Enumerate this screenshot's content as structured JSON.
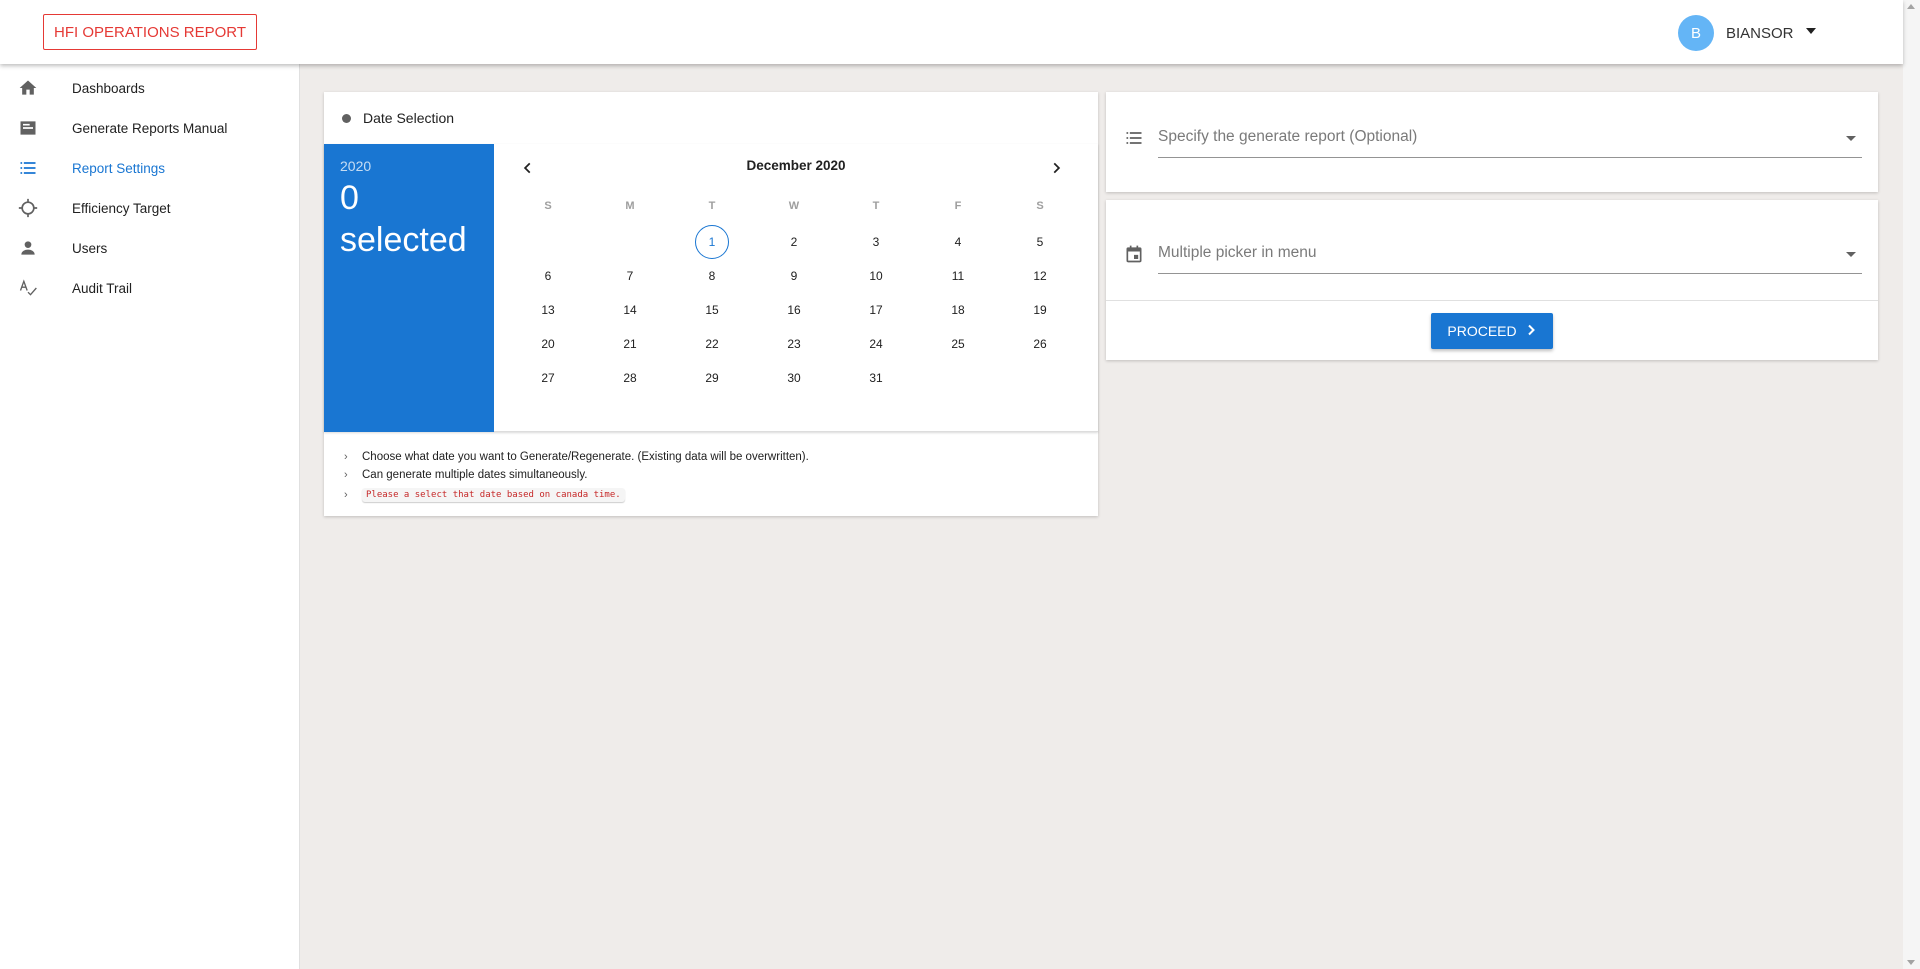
{
  "app": {
    "title": "HFI OPERATIONS REPORT"
  },
  "user": {
    "initial": "B",
    "name": "BIANSOR"
  },
  "sidebar": {
    "items": [
      {
        "label": "Dashboards",
        "icon": "home-icon"
      },
      {
        "label": "Generate Reports Manual",
        "icon": "report-icon"
      },
      {
        "label": "Report Settings",
        "icon": "list-icon",
        "active": true
      },
      {
        "label": "Efficiency Target",
        "icon": "target-icon"
      },
      {
        "label": "Users",
        "icon": "person-icon"
      },
      {
        "label": "Audit Trail",
        "icon": "signature-icon"
      }
    ]
  },
  "date_selection": {
    "title": "Date Selection",
    "picker": {
      "year": "2020",
      "selected_count": "0",
      "selected_label": "selected",
      "month": "December 2020",
      "weekdays": [
        "S",
        "M",
        "T",
        "W",
        "T",
        "F",
        "S"
      ],
      "first_weekday_index": 2,
      "days_in_month": 31,
      "today": 1
    },
    "notes": [
      "Choose what date you want to Generate/Regenerate. (Existing data will be overwritten).",
      "Can generate multiple dates simultaneously.",
      "Please a select that date based on canada time."
    ]
  },
  "report_select": {
    "placeholder": "Specify the generate report (Optional)",
    "icon": "list-icon"
  },
  "date_menu": {
    "placeholder": "Multiple picker in menu",
    "icon": "calendar-icon"
  },
  "proceed": {
    "label": "PROCEED"
  },
  "colors": {
    "primary": "#1976d2",
    "brand": "#e53935",
    "avatar": "#64b5f6"
  }
}
